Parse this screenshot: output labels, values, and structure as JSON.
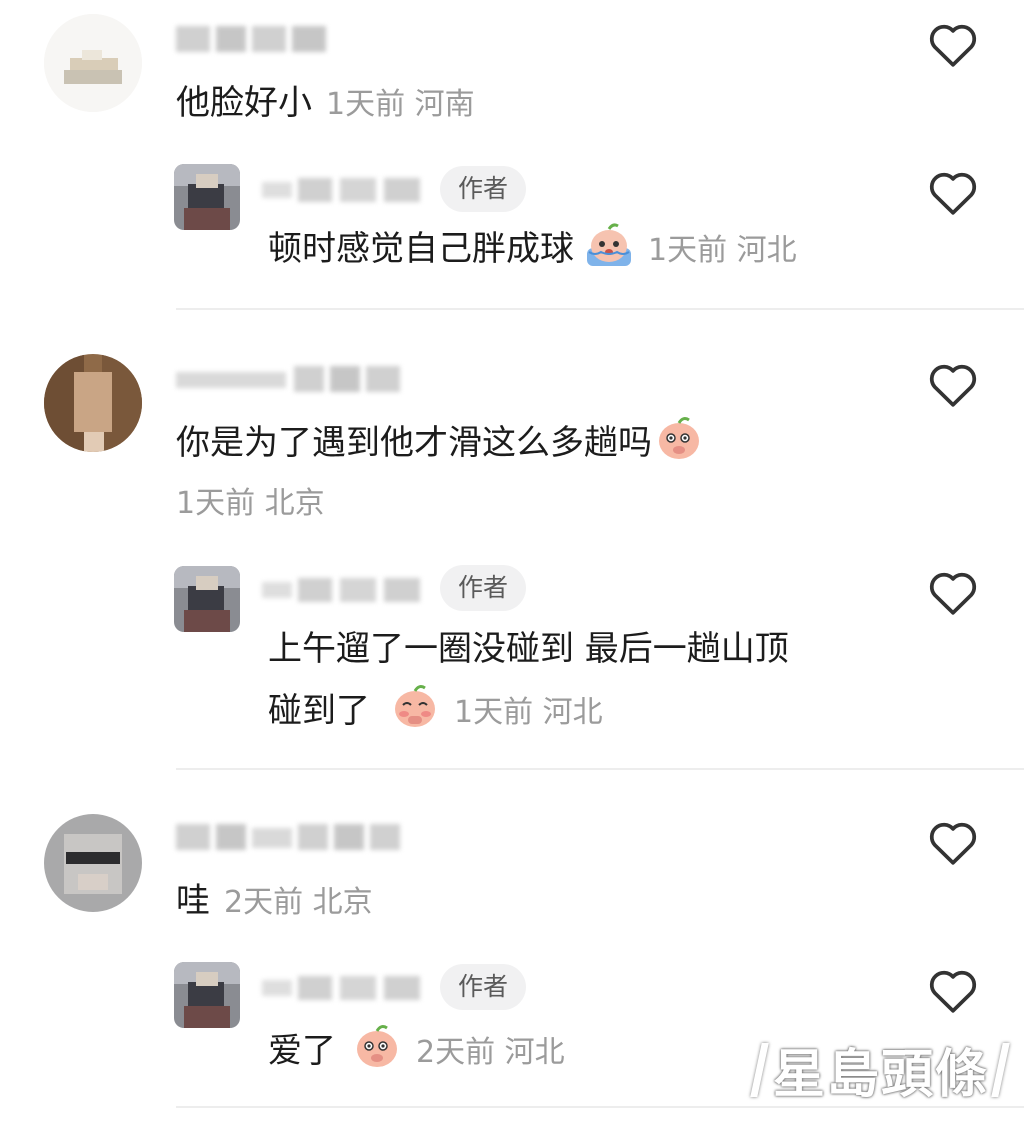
{
  "comments": [
    {
      "text": "他脸好小",
      "meta": "1天前 河南",
      "reply": {
        "badge": "作者",
        "text": "顿时感觉自己胖成球",
        "meta": "1天前 河北"
      }
    },
    {
      "text": "你是为了遇到他才滑这么多趟吗",
      "meta": "1天前 北京",
      "reply": {
        "badge": "作者",
        "text_line1": "上午遛了一圈没碰到 最后一趟山顶",
        "text_line2": "碰到了",
        "meta": "1天前 河北"
      }
    },
    {
      "text": "哇",
      "meta": "2天前 北京",
      "reply": {
        "badge": "作者",
        "text": "爱了",
        "meta": "2天前 河北"
      }
    }
  ],
  "icons": {
    "like": "heart-outline-icon",
    "emoji_cry": "crying-peach-emoji",
    "emoji_think": "thinking-peach-emoji",
    "emoji_shy": "shy-peach-emoji"
  },
  "colors": {
    "text": "#1c1c1c",
    "meta": "#9b9b9b",
    "badge_bg": "#f1f1f2",
    "divider": "#ededed"
  },
  "watermark": "星島頭條"
}
